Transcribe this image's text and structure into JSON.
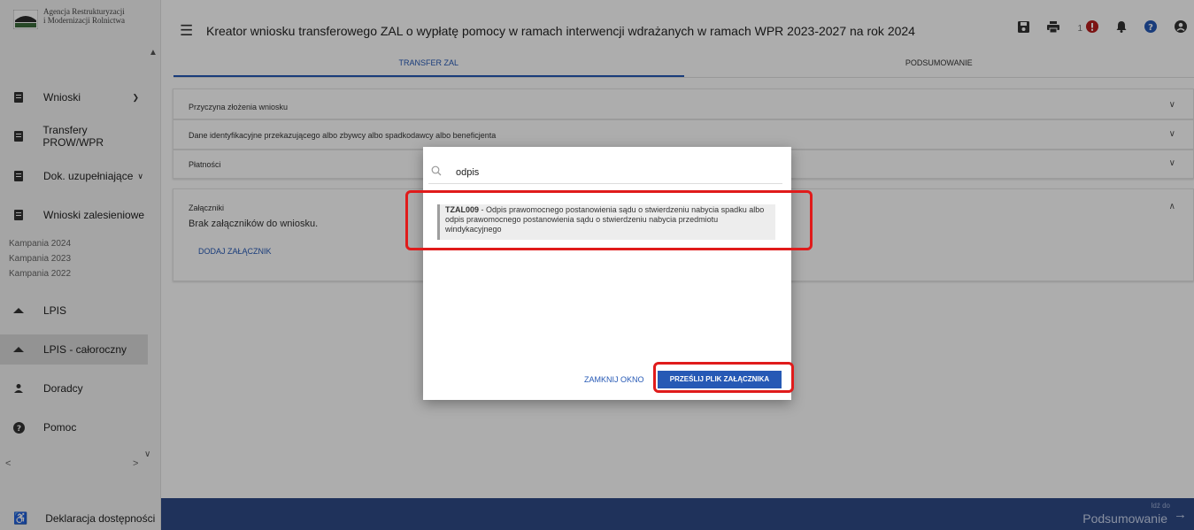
{
  "sidebar": {
    "logo_line1": "Agencja Restrukturyzacji",
    "logo_line2": "i Modernizacji Rolnictwa",
    "items": [
      {
        "label": "Wnioski"
      },
      {
        "label": "Transfery PROW/WPR"
      },
      {
        "label": "Dok. uzupełniające"
      },
      {
        "label": "Wnioski zalesieniowe"
      },
      {
        "label": "LPIS"
      },
      {
        "label": "LPIS - całoroczny"
      },
      {
        "label": "Doradcy"
      },
      {
        "label": "Pomoc"
      }
    ],
    "campaigns": [
      "Kampania 2024",
      "Kampania 2023",
      "Kampania 2022"
    ],
    "accessibility": "Deklaracja dostępności"
  },
  "header": {
    "title": "Kreator wniosku transferowego ZAL o wypłatę pomocy w ramach interwencji wdrażanych w ramach WPR 2023-2027 na rok 2024",
    "notification_count": "1",
    "tabs": [
      {
        "label": "TRANSFER ZAL"
      },
      {
        "label": "PODSUMOWANIE"
      }
    ]
  },
  "sections": [
    {
      "title": "Przyczyna złożenia wniosku"
    },
    {
      "title": "Dane identyfikacyjne przekazującego albo zbywcy albo spadkodawcy albo beneficjenta"
    },
    {
      "title": "Płatności"
    }
  ],
  "attachments": {
    "title": "Załączniki",
    "empty": "Brak załączników do wniosku.",
    "add": "DODAJ ZAŁĄCZNIK"
  },
  "footer": {
    "small": "Idź do",
    "big": "Podsumowanie"
  },
  "modal": {
    "search_value": "odpis",
    "result_code": "TZAL009",
    "result_text": " - Odpis prawomocnego postanowienia sądu o stwierdzeniu nabycia spadku albo odpis prawomocnego postanowienia sądu o stwierdzeniu nabycia przedmiotu windykacyjnego",
    "close_label": "ZAMKNIJ OKNO",
    "upload_label": "PRZEŚLIJ PLIK ZAŁĄCZNIKA"
  },
  "colors": {
    "accent": "#2659b5",
    "highlight": "#e01b1b",
    "footer": "#2e4a86"
  },
  "icons": [
    "menu-icon",
    "save-icon",
    "print-icon",
    "alert-icon",
    "bell-icon",
    "help-icon",
    "account-icon",
    "search-icon",
    "document-icon",
    "mountain-icon",
    "person-icon",
    "help-circle-icon",
    "accessibility-icon",
    "chevron-down-icon",
    "chevron-up-icon",
    "arrow-right-icon"
  ]
}
